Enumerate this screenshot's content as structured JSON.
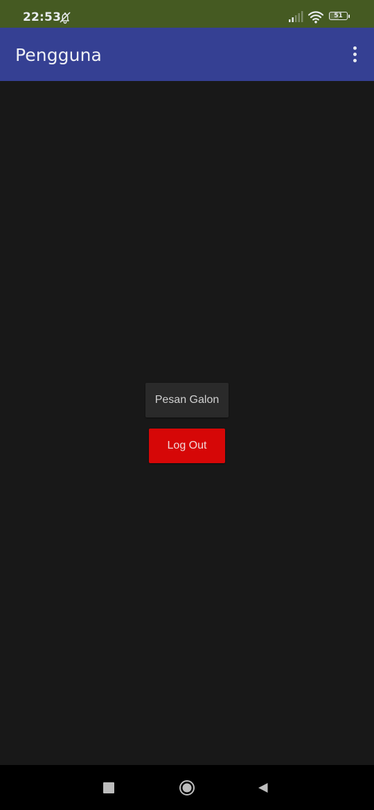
{
  "status_bar": {
    "time": "22:53",
    "battery": "51",
    "battery_percent": 51,
    "icons": [
      "bell-off-icon",
      "signal-icon",
      "wifi-icon",
      "battery-icon"
    ]
  },
  "app_bar": {
    "title": "Pengguna",
    "menu_icon": "more-vert-icon",
    "background": "#354093"
  },
  "content": {
    "background": "#181818"
  },
  "buttons": {
    "pesan_galon": "Pesan Galon",
    "log_out": "Log Out",
    "log_out_color": "#d60707"
  },
  "nav_bar": {
    "items": [
      "recent-apps-icon",
      "home-icon",
      "back-icon"
    ]
  }
}
